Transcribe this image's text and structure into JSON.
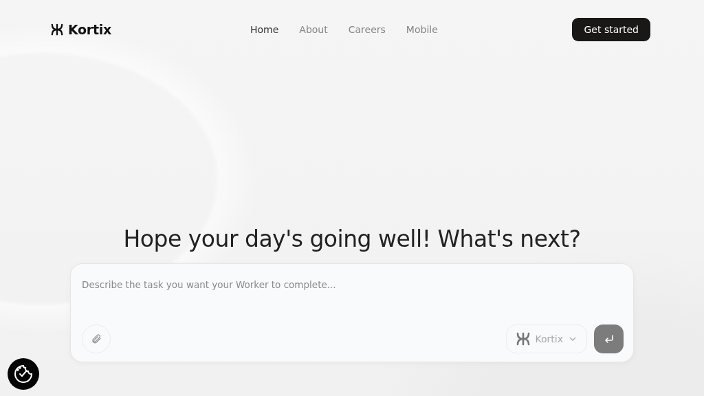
{
  "header": {
    "brand": "Kortix",
    "nav": [
      {
        "label": "Home",
        "selected": true
      },
      {
        "label": "About",
        "selected": false
      },
      {
        "label": "Careers",
        "selected": false
      },
      {
        "label": "Mobile",
        "selected": false
      }
    ],
    "cta": "Get started"
  },
  "hero": {
    "heading": "Hope your day's going well! What's next?"
  },
  "composer": {
    "placeholder": "Describe the task you want your Worker to complete...",
    "agent": "Kortix"
  }
}
